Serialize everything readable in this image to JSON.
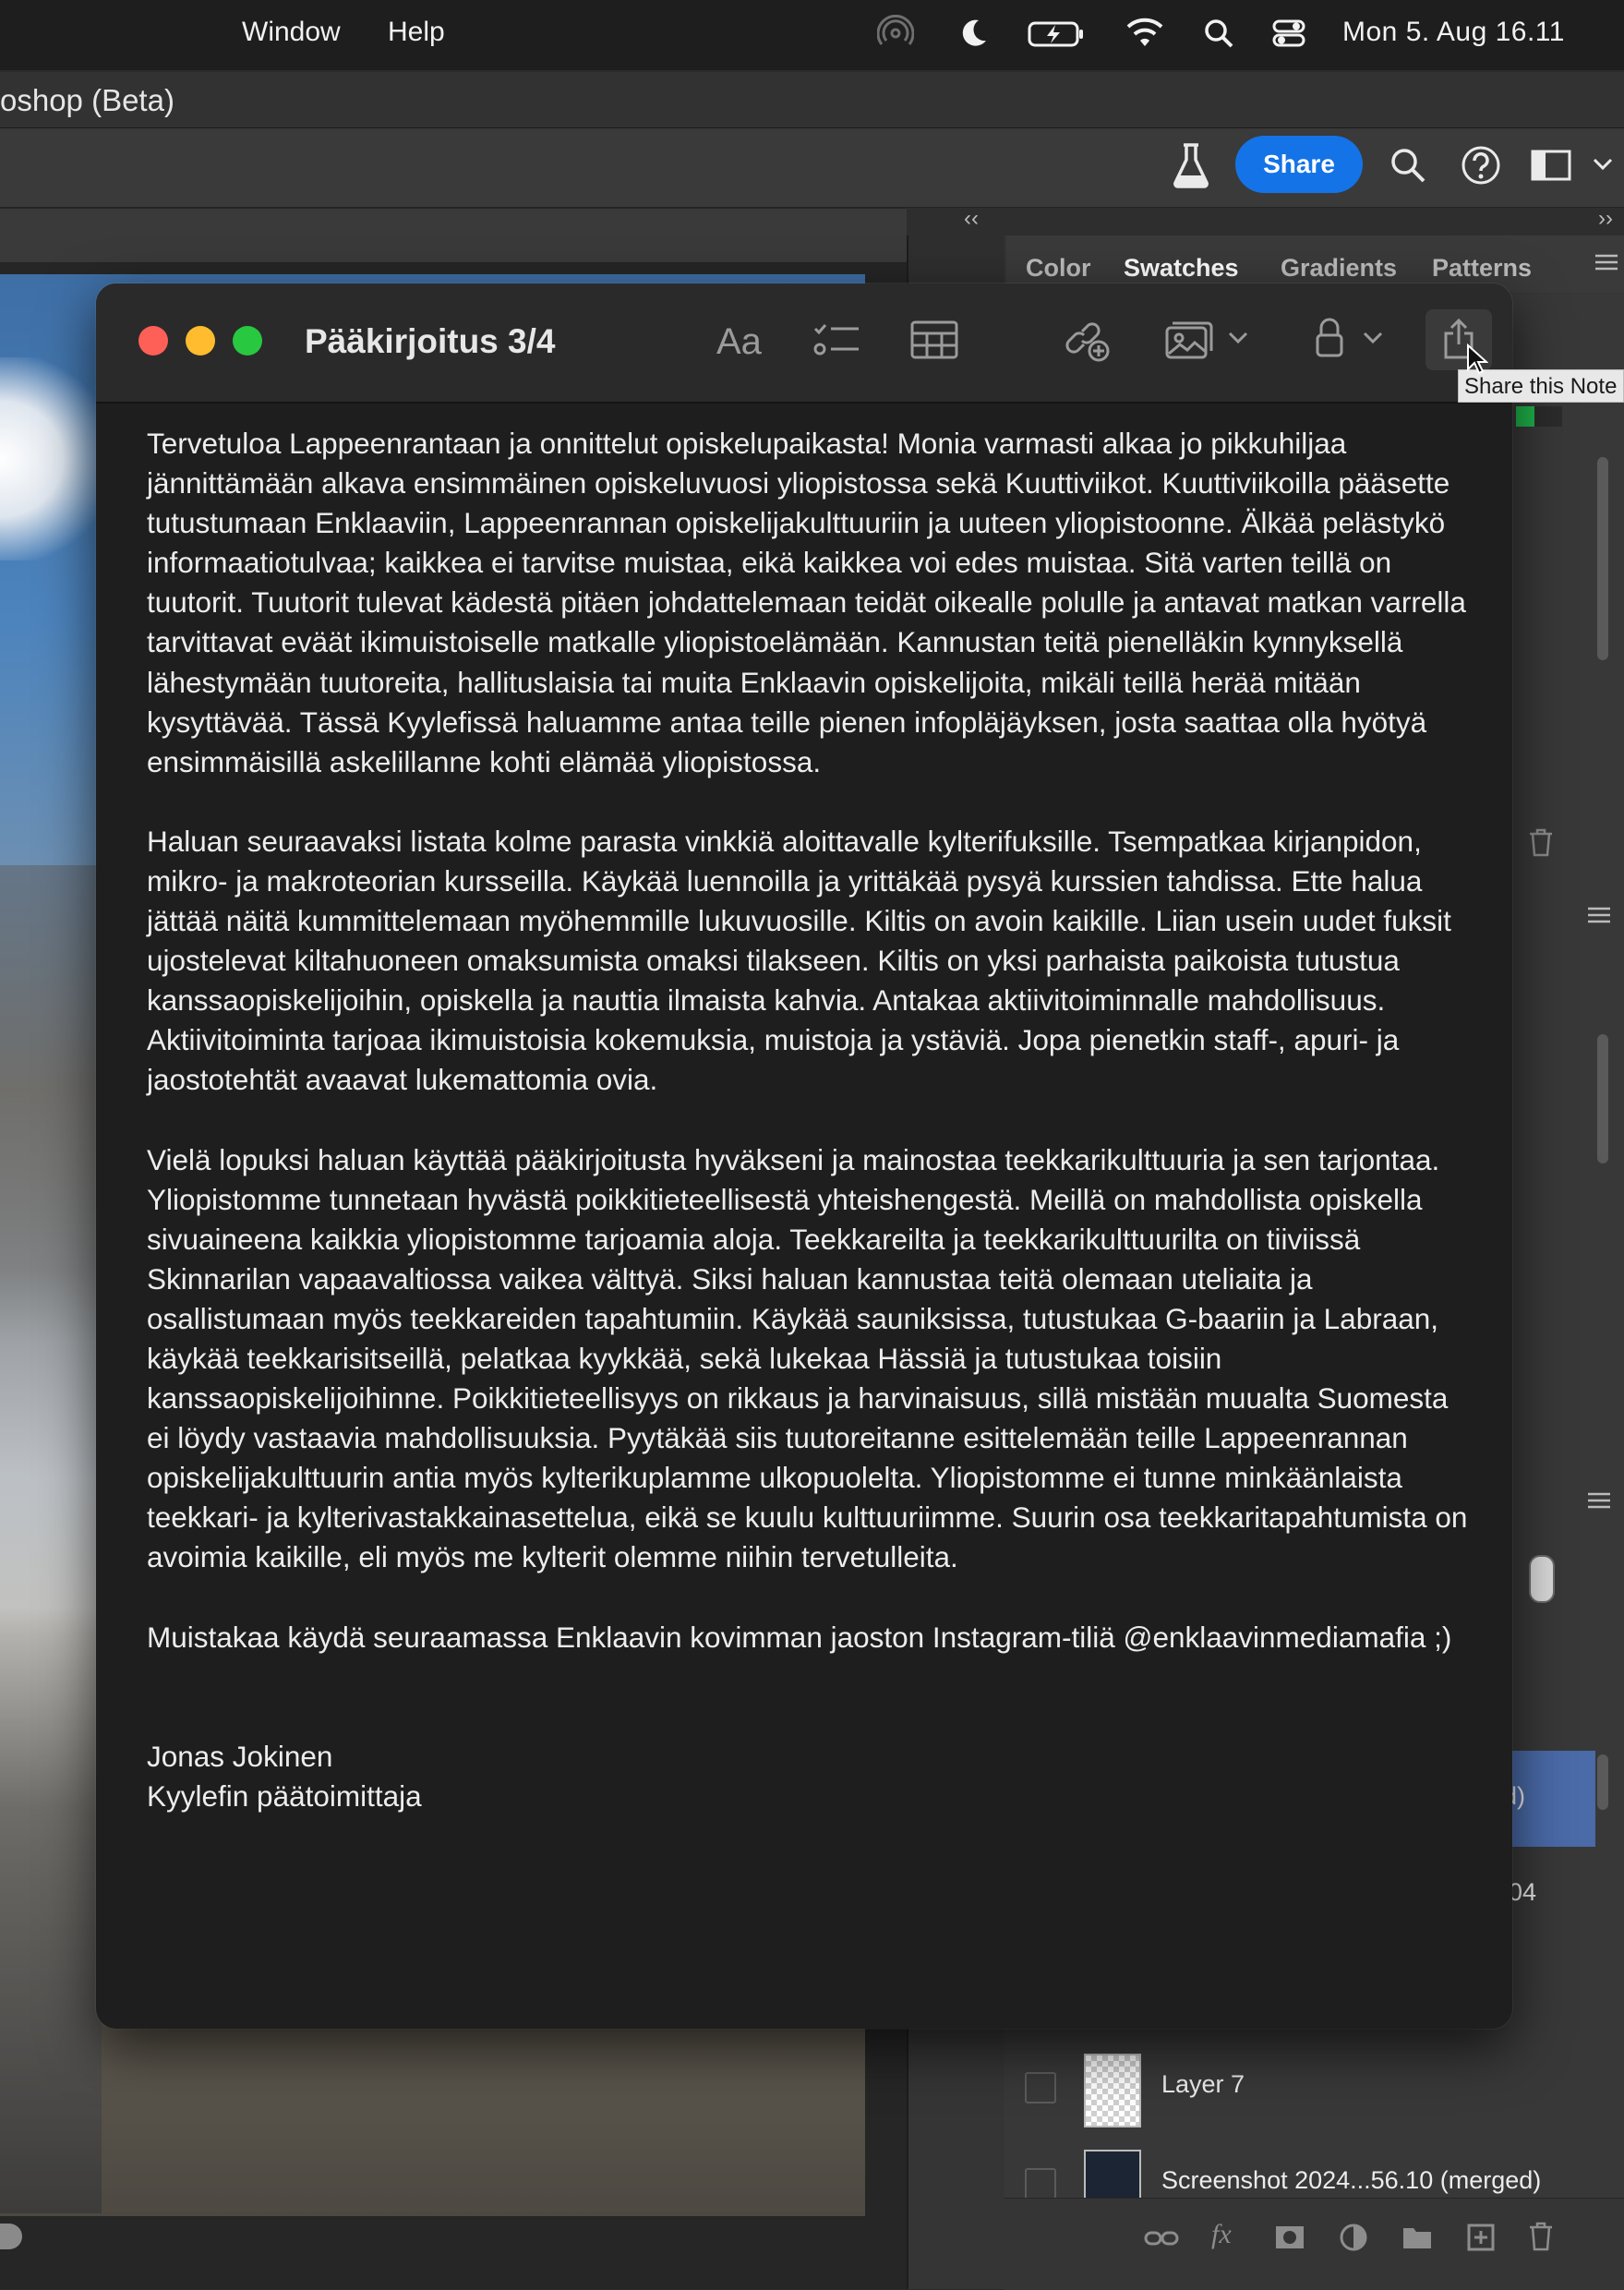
{
  "menubar": {
    "items": [
      "Window",
      "Help"
    ],
    "clock": "Mon 5. Aug  16.11",
    "icons": [
      "airdrop-icon",
      "focus-moon-icon",
      "battery-charging-icon",
      "wifi-icon",
      "spotlight-search-icon",
      "control-center-icon"
    ]
  },
  "photoshop": {
    "window_title": "oshop (Beta)",
    "share_label": "Share",
    "panel_tabs": [
      "Color",
      "Swatches",
      "Gradients",
      "Patterns"
    ],
    "active_tab": "Swatches",
    "layers": [
      {
        "name": "d)",
        "selected": true
      },
      {
        "name": "04",
        "selected": false
      },
      {
        "name": "",
        "selected": false
      },
      {
        "name": "Layer 7",
        "selected": false
      },
      {
        "name": "Screenshot 2024...56.10 (merged)",
        "selected": false
      }
    ]
  },
  "note": {
    "title": "Pääkirjoitus 3/4",
    "tooltip": "Share this Note",
    "paragraphs": [
      "Tervetuloa Lappeenrantaan ja onnittelut opiskelupaikasta! Monia varmasti alkaa jo pikkuhiljaa jännittämään alkava ensimmäinen opiskeluvuosi yliopistossa sekä Kuuttiviikot. Kuuttiviikoilla pääsette tutustumaan Enklaaviin, Lappeenrannan opiskelijakulttuuriin ja uuteen yliopistoonne. Älkää pelästykö informaatiotulvaa; kaikkea ei tarvitse muistaa, eikä kaikkea voi edes muistaa. Sitä varten teillä on tuutorit. Tuutorit tulevat kädestä pitäen johdattelemaan teidät oikealle polulle ja antavat matkan varrella tarvittavat eväät ikimuistoiselle matkalle yliopistoelämään. Kannustan teitä pienelläkin kynnyksellä lähestymään tuutoreita, hallituslaisia tai muita Enklaavin opiskelijoita, mikäli teillä herää mitään kysyttävää. Tässä Kyylefissä haluamme antaa teille pienen infopläjäyksen, josta saattaa olla hyötyä ensimmäisillä askelillanne kohti elämää yliopistossa.",
      "Haluan seuraavaksi listata kolme parasta vinkkiä aloittavalle kylterifuksille. Tsempatkaa kirjanpidon, mikro- ja makroteorian kursseilla. Käykää luennoilla ja yrittäkää pysyä kurssien tahdissa. Ette halua jättää näitä kummittelemaan myöhemmille lukuvuosille. Kiltis on avoin kaikille. Liian usein uudet fuksit ujostelevat kiltahuoneen omaksumista omaksi tilakseen. Kiltis on yksi parhaista paikoista tutustua kanssaopiskelijoihin, opiskella ja nauttia ilmaista kahvia. Antakaa aktiivitoiminnalle mahdollisuus. Aktiivitoiminta tarjoaa ikimuistoisia kokemuksia, muistoja ja ystäviä. Jopa pienetkin staff-, apuri- ja jaostotehtät avaavat lukemattomia ovia.",
      "Vielä lopuksi haluan käyttää pääkirjoitusta hyväkseni ja mainostaa teekkarikulttuuria ja sen tarjontaa. Yliopistomme tunnetaan hyvästä poikkitieteellisestä yhteishengestä. Meillä on mahdollista opiskella sivuaineena kaikkia yliopistomme tarjoamia aloja. Teekkareilta ja teekkarikulttuurilta on tiiviissä Skinnarilan vapaavaltiossa vaikea välttyä. Siksi haluan kannustaa teitä olemaan uteliaita ja osallistumaan myös teekkareiden tapahtumiin. Käykää sauniksissa, tutustukaa G-baariin ja Labraan, käykää teekkarisitseillä, pelatkaa kyykkää, sekä lukekaa Hässiä ja tutustukaa toisiin kanssaopiskelijoihinne. Poikkitieteellisyys on rikkaus ja harvinaisuus, sillä mistään muualta Suomesta ei löydy vastaavia mahdollisuuksia. Pyytäkää siis tuutoreitanne esittelemään teille Lappeenrannan opiskelijakulttuurin antia myös kylterikuplamme ulkopuolelta. Yliopistomme ei tunne minkäänlaista teekkari- ja kylterivastakkainasettelua, eikä se kuulu kulttuuriimme. Suurin osa teekkaritapahtumista on avoimia kaikille, eli myös me kylterit olemme niihin tervetulleita.",
      "Muistakaa käydä seuraamassa Enklaavin kovimman jaoston Instagram-tiliä @enklaavinmediamafia ;)"
    ],
    "signature_name": "Jonas Jokinen",
    "signature_role": "Kyylefin päätoimittaja"
  }
}
